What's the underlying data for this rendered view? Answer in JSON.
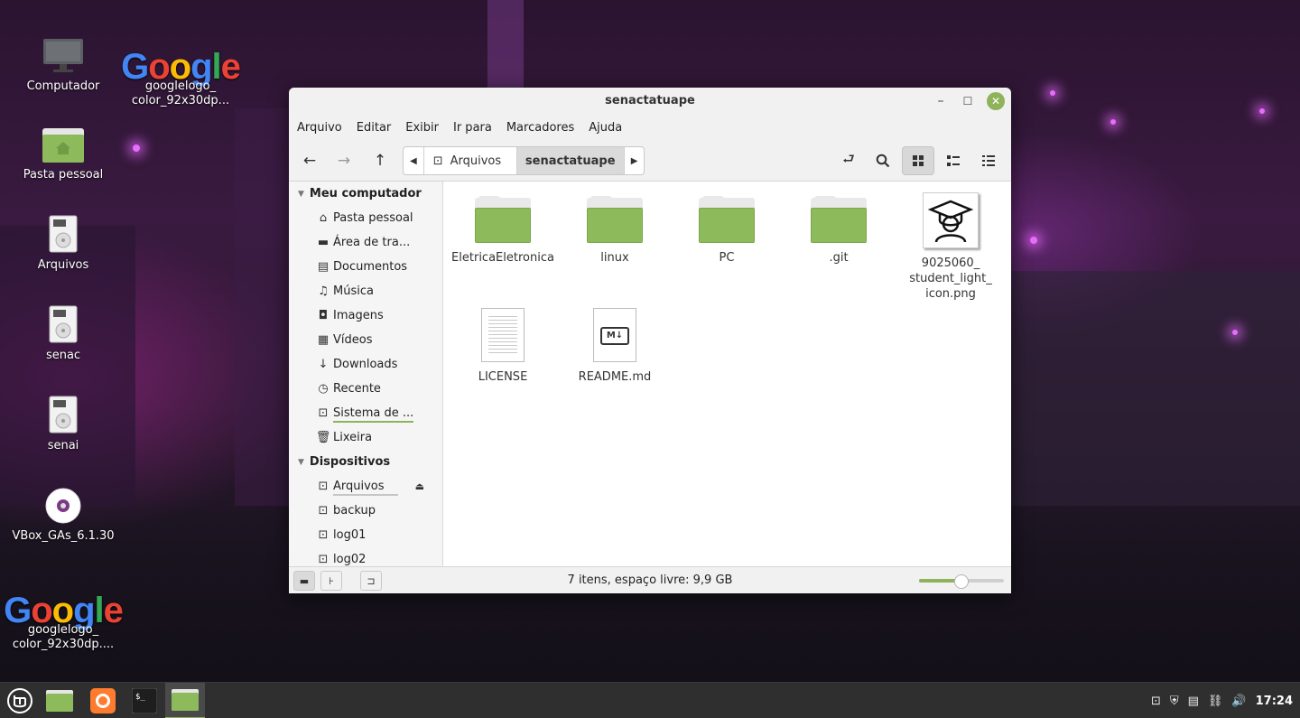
{
  "desktop": {
    "icons": [
      {
        "label": "Computador"
      },
      {
        "label": "googlelogo_\ncolor_92x30dp..."
      },
      {
        "label": "Pasta pessoal"
      },
      {
        "label": "Arquivos"
      },
      {
        "label": "senac"
      },
      {
        "label": "senai"
      },
      {
        "label": "VBox_GAs_6.1.30"
      },
      {
        "label": "googlelogo_\ncolor_92x30dp...."
      }
    ],
    "google_logo_text": [
      "G",
      "o",
      "o",
      "g",
      "l",
      "e"
    ]
  },
  "window": {
    "title": "senactatuape",
    "controls": {
      "minimize": "–",
      "maximize": "☐",
      "close": "✕"
    },
    "menu": [
      "Arquivo",
      "Editar",
      "Exibir",
      "Ir para",
      "Marcadores",
      "Ajuda"
    ],
    "path": {
      "root": "Arquivos",
      "current": "senactatuape"
    },
    "sidebar": {
      "section1": "Meu computador",
      "computer_items": [
        {
          "label": "Pasta pessoal",
          "icon": "home-icon"
        },
        {
          "label": "Área de tra...",
          "icon": "desktop-icon"
        },
        {
          "label": "Documentos",
          "icon": "document-icon"
        },
        {
          "label": "Música",
          "icon": "music-icon"
        },
        {
          "label": "Imagens",
          "icon": "camera-icon"
        },
        {
          "label": "Vídeos",
          "icon": "film-icon"
        },
        {
          "label": "Downloads",
          "icon": "download-icon"
        },
        {
          "label": "Recente",
          "icon": "clock-icon"
        },
        {
          "label": "Sistema de ...",
          "icon": "drive-icon"
        },
        {
          "label": "Lixeira",
          "icon": "trash-icon"
        }
      ],
      "section2": "Dispositivos",
      "device_items": [
        {
          "label": "Arquivos"
        },
        {
          "label": "backup"
        },
        {
          "label": "log01"
        },
        {
          "label": "log02"
        }
      ]
    },
    "files": [
      {
        "name": "EletricaEletronica",
        "type": "folder"
      },
      {
        "name": "linux",
        "type": "folder"
      },
      {
        "name": "PC",
        "type": "folder"
      },
      {
        "name": ".git",
        "type": "folder"
      },
      {
        "name": "9025060_\nstudent_light_\nicon.png",
        "type": "image"
      },
      {
        "name": "LICENSE",
        "type": "text"
      },
      {
        "name": "README.md",
        "type": "markdown"
      }
    ],
    "md_badge": "M↓",
    "status": "7 itens, espaço livre: 9,9 GB",
    "zoom_level": 0.5
  },
  "panel": {
    "clock": "17:24",
    "accent": "#8fb35a"
  }
}
